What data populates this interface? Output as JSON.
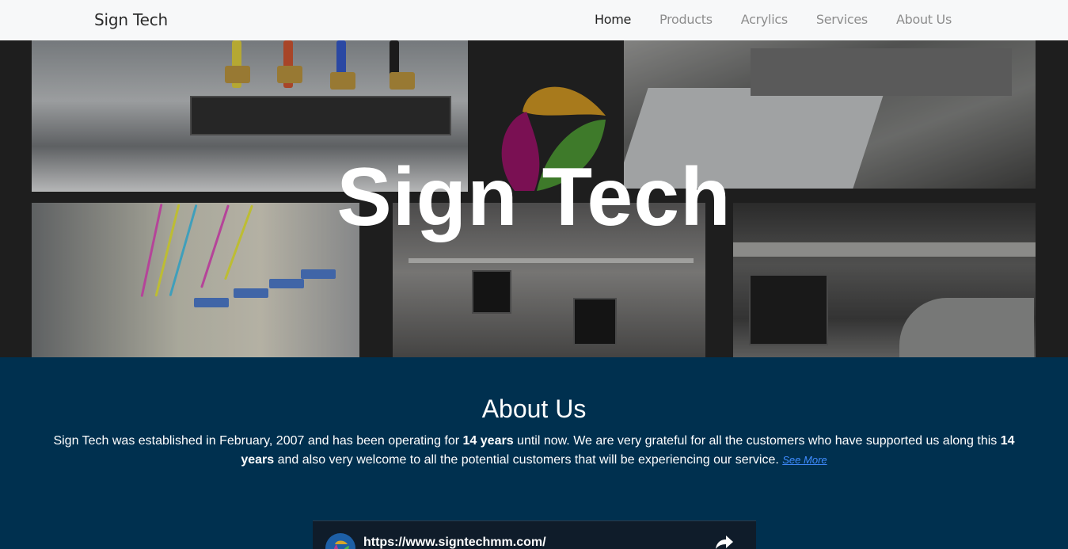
{
  "navbar": {
    "brand": "Sign Tech",
    "items": [
      {
        "label": "Home",
        "active": true
      },
      {
        "label": "Products",
        "active": false
      },
      {
        "label": "Acrylics",
        "active": false
      },
      {
        "label": "Services",
        "active": false
      },
      {
        "label": "About Us",
        "active": false
      }
    ]
  },
  "hero": {
    "title": "Sign Tech",
    "logo_colors": [
      "#a87a1c",
      "#7a1053",
      "#3e7a2a"
    ]
  },
  "about": {
    "heading": "About Us",
    "text_1": "Sign Tech was established in February, 2007 and has been operating for ",
    "years_1": "14 years",
    "text_2": " until now. We are very grateful for all the customers who have supported us along this ",
    "years_2": "14 years",
    "text_3": " and also very welcome to all the potential customers that will be experiencing our service. ",
    "see_more": "See More"
  },
  "embed": {
    "url": "https://www.signtechmm.com/",
    "icon": "share-icon"
  },
  "colors": {
    "navbar_bg": "#f7f8f9",
    "about_bg": "#00304f",
    "link": "#3f8cff"
  }
}
